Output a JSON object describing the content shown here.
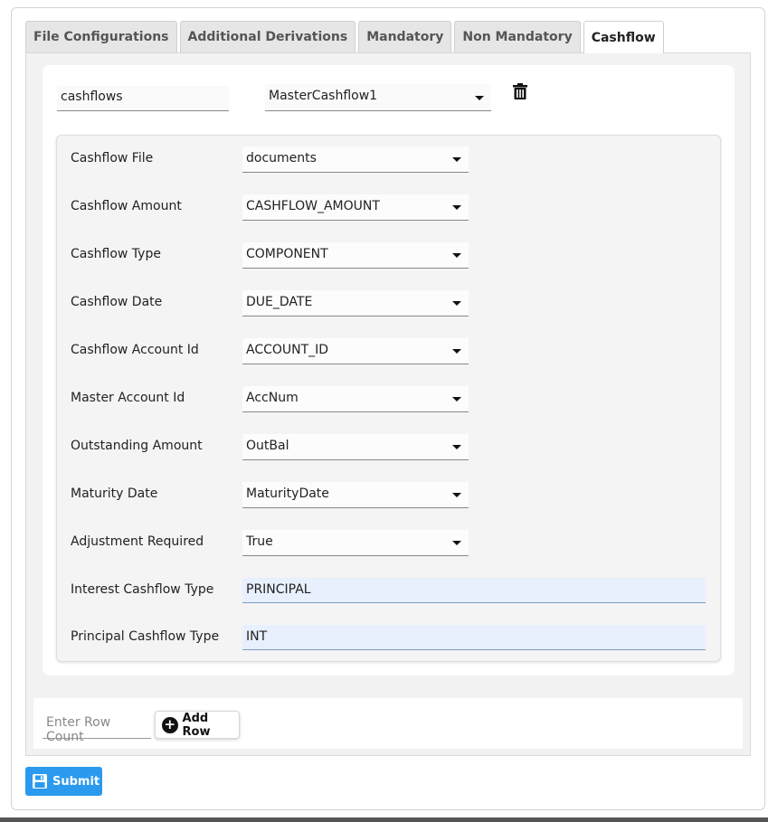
{
  "tabs": [
    {
      "label": "File Configurations",
      "active": false
    },
    {
      "label": "Additional Derivations",
      "active": false
    },
    {
      "label": "Mandatory",
      "active": false
    },
    {
      "label": "Non Mandatory",
      "active": false
    },
    {
      "label": "Cashflow",
      "active": true
    }
  ],
  "header": {
    "name_value": "cashflows",
    "config_select_value": "MasterCashflow1",
    "delete_icon": "trash-icon"
  },
  "fields": [
    {
      "label": "Cashflow File",
      "value": "documents",
      "kind": "select"
    },
    {
      "label": "Cashflow Amount",
      "value": "CASHFLOW_AMOUNT",
      "kind": "select"
    },
    {
      "label": "Cashflow Type",
      "value": "COMPONENT",
      "kind": "select"
    },
    {
      "label": "Cashflow Date",
      "value": "DUE_DATE",
      "kind": "select"
    },
    {
      "label": "Cashflow Account Id",
      "value": "ACCOUNT_ID",
      "kind": "select"
    },
    {
      "label": "Master Account Id",
      "value": "AccNum",
      "kind": "select"
    },
    {
      "label": "Outstanding Amount",
      "value": "OutBal",
      "kind": "select"
    },
    {
      "label": "Maturity Date",
      "value": "MaturityDate",
      "kind": "select"
    },
    {
      "label": "Adjustment Required",
      "value": "True",
      "kind": "select"
    },
    {
      "label": "Interest Cashflow Type",
      "value": "PRINCIPAL",
      "kind": "text"
    },
    {
      "label": "Principal Cashflow Type",
      "value": "INT",
      "kind": "text"
    }
  ],
  "row_controls": {
    "row_count_placeholder": "Enter Row Count",
    "add_row_label": "Add Row"
  },
  "submit_label": "Submit",
  "colors": {
    "submit_bg": "#2b99ee",
    "text_input_bg": "#e8f0fe"
  }
}
